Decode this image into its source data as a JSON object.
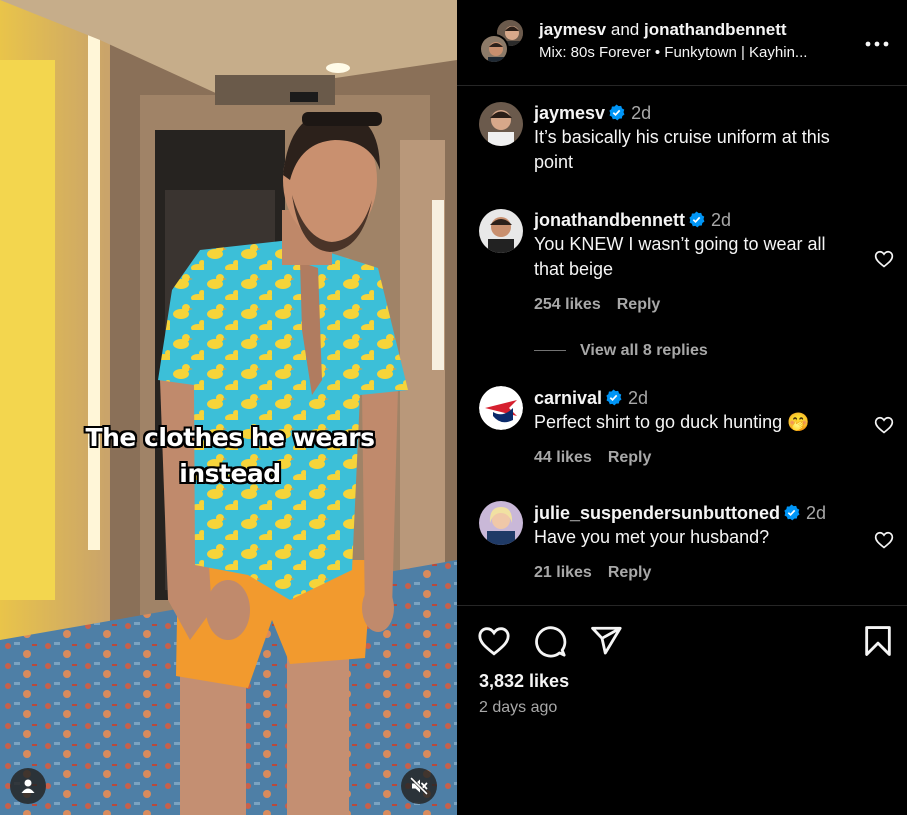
{
  "video": {
    "caption_line1": "The clothes he wears",
    "caption_line2": "instead"
  },
  "header": {
    "user1": "jaymesv",
    "and_text": "and",
    "user2": "jonathandbennett",
    "audio": "Mix: 80s Forever • Funkytown | Kayhin..."
  },
  "comments": [
    {
      "username": "jaymesv",
      "verified": true,
      "time": "2d",
      "text_line1": "It’s basically his cruise uniform at this",
      "text_line2": "point"
    },
    {
      "username": "jonathandbennett",
      "verified": true,
      "time": "2d",
      "text_line1": "You KNEW I wasn’t going to wear all",
      "text_line2": "that beige",
      "likes": "254 likes",
      "reply": "Reply"
    },
    {
      "username": "carnival",
      "verified": true,
      "time": "2d",
      "text": "Perfect shirt to go duck hunting 🤭",
      "likes": "44 likes",
      "reply": "Reply"
    },
    {
      "username": "julie_suspendersunbuttoned",
      "verified": true,
      "time": "2d",
      "text": "Have you met your husband?",
      "likes": "21 likes",
      "reply": "Reply"
    }
  ],
  "view_replies": "View all 8 replies",
  "post": {
    "likes": "3,832 likes",
    "posted": "2 days ago"
  },
  "colors": {
    "verified": "#0095f6",
    "shirt": "#3cbfd8",
    "shorts": "#f29a2e",
    "duck": "#f6d43a"
  },
  "icons": [
    "user-icon",
    "muted-icon",
    "more-icon",
    "verified-icon",
    "heart-icon",
    "comment-icon",
    "share-icon",
    "bookmark-icon"
  ]
}
